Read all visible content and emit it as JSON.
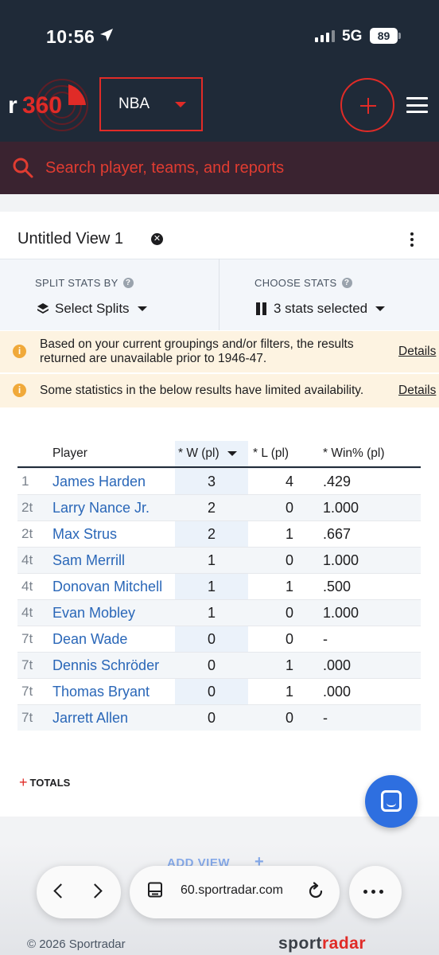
{
  "status_bar": {
    "time": "10:56",
    "network": "5G",
    "battery": "89"
  },
  "header": {
    "logo_text": "r360",
    "league": "NBA",
    "search_placeholder": "Search player, teams, and reports"
  },
  "view": {
    "title": "Untitled View 1",
    "split_label": "SPLIT STATS BY",
    "split_value": "Select Splits",
    "stats_label": "CHOOSE STATS",
    "stats_value": "3 stats selected"
  },
  "notices": [
    {
      "text": "Based on your current groupings and/or filters, the results returned are unavailable prior to 1946-47.",
      "link": "Details"
    },
    {
      "text": "Some statistics in the below results have limited availability.",
      "link": "Details"
    }
  ],
  "table": {
    "headers": {
      "rank": "",
      "player": "Player",
      "w": "* W (pl)",
      "l": "* L (pl)",
      "pct": "* Win% (pl)"
    },
    "rows": [
      {
        "rank": "1",
        "player": "James Harden",
        "w": "3",
        "l": "4",
        "pct": ".429"
      },
      {
        "rank": "2t",
        "player": "Larry Nance Jr.",
        "w": "2",
        "l": "0",
        "pct": "1.000"
      },
      {
        "rank": "2t",
        "player": "Max Strus",
        "w": "2",
        "l": "1",
        "pct": ".667"
      },
      {
        "rank": "4t",
        "player": "Sam Merrill",
        "w": "1",
        "l": "0",
        "pct": "1.000"
      },
      {
        "rank": "4t",
        "player": "Donovan Mitchell",
        "w": "1",
        "l": "1",
        "pct": ".500"
      },
      {
        "rank": "4t",
        "player": "Evan Mobley",
        "w": "1",
        "l": "0",
        "pct": "1.000"
      },
      {
        "rank": "7t",
        "player": "Dean Wade",
        "w": "0",
        "l": "0",
        "pct": "-"
      },
      {
        "rank": "7t",
        "player": "Dennis Schröder",
        "w": "0",
        "l": "1",
        "pct": ".000"
      },
      {
        "rank": "7t",
        "player": "Thomas Bryant",
        "w": "0",
        "l": "1",
        "pct": ".000"
      },
      {
        "rank": "7t",
        "player": "Jarrett Allen",
        "w": "0",
        "l": "0",
        "pct": "-"
      }
    ]
  },
  "totals_label": "TOTALS",
  "add_view_label": "ADD VIEW",
  "browser": {
    "url": "60.sportradar.com"
  },
  "footer": {
    "copyright": "© 2026 Sportradar",
    "brand_a": "sport",
    "brand_b": "radar"
  },
  "colors": {
    "accent": "#e02b27",
    "header_bg": "#1f2a38",
    "link": "#2a67b8",
    "notice_bg": "#fdf3e1"
  },
  "icons": [
    "location-arrow-icon",
    "signal-icon",
    "battery-icon",
    "chevron-down-icon",
    "plus-icon",
    "hamburger-menu-icon",
    "search-icon",
    "close-icon",
    "kebab-icon",
    "help-icon",
    "layers-icon",
    "columns-icon",
    "info-icon",
    "chat-icon",
    "back-icon",
    "forward-icon",
    "reader-icon",
    "reload-icon",
    "more-icon"
  ]
}
